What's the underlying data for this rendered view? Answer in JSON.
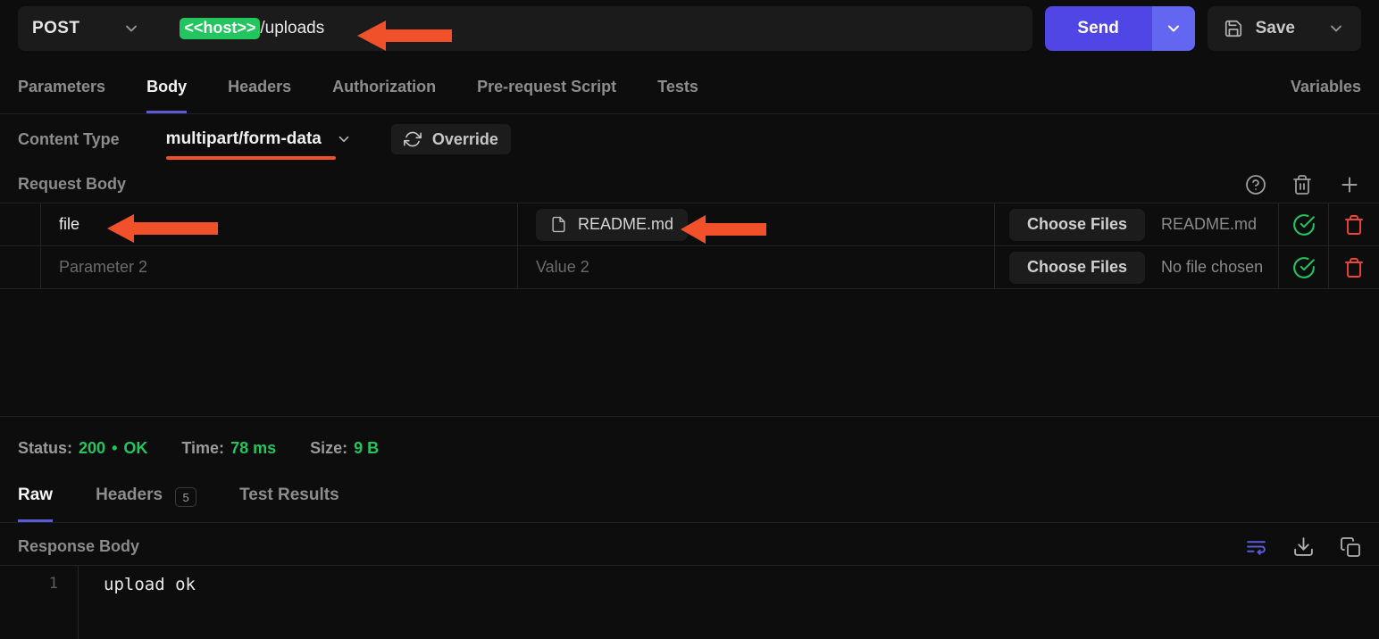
{
  "request_bar": {
    "method": "POST",
    "url_variable": "<<host>>",
    "url_path": "/uploads",
    "send_label": "Send",
    "save_label": "Save",
    "accent_color": "#4f46e5",
    "variable_chip_color": "#22c55e"
  },
  "request_tabs": {
    "items": [
      {
        "label": "Parameters",
        "active": false
      },
      {
        "label": "Body",
        "active": true
      },
      {
        "label": "Headers",
        "active": false
      },
      {
        "label": "Authorization",
        "active": false
      },
      {
        "label": "Pre-request Script",
        "active": false
      },
      {
        "label": "Tests",
        "active": false
      }
    ],
    "right_item": "Variables"
  },
  "content_type": {
    "label": "Content Type",
    "value": "multipart/form-data",
    "override_label": "Override",
    "underline_color": "#f0502a"
  },
  "request_body": {
    "title": "Request Body",
    "icons": [
      "help-circle-icon",
      "trash-icon",
      "plus-icon"
    ],
    "rows": [
      {
        "key": "file",
        "key_is_placeholder": false,
        "value": "README.md",
        "value_is_placeholder": false,
        "value_is_file_chip": true,
        "choose_files_label": "Choose Files",
        "file_status": "README.md",
        "file_status_muted": false
      },
      {
        "key": "Parameter 2",
        "key_is_placeholder": true,
        "value": "Value 2",
        "value_is_placeholder": true,
        "value_is_file_chip": false,
        "choose_files_label": "Choose Files",
        "file_status": "No file chosen",
        "file_status_muted": true
      }
    ]
  },
  "status": {
    "status_label": "Status:",
    "status_value": "200",
    "status_sep": "•",
    "status_text": "OK",
    "time_label": "Time:",
    "time_value": "78 ms",
    "size_label": "Size:",
    "size_value": "9 B",
    "success_color": "#22c55e"
  },
  "response_tabs": {
    "items": [
      {
        "label": "Raw",
        "active": true,
        "badge": ""
      },
      {
        "label": "Headers",
        "active": false,
        "badge": "5"
      },
      {
        "label": "Test Results",
        "active": false,
        "badge": ""
      }
    ]
  },
  "response_body": {
    "title": "Response Body",
    "icons": [
      "word-wrap-icon",
      "download-icon",
      "copy-icon"
    ],
    "line_number": "1",
    "content": "upload ok"
  },
  "annotations": {
    "arrow_color": "#f0502a",
    "arrows": [
      {
        "name": "arrow-to-url",
        "target": "url-field"
      },
      {
        "name": "arrow-to-param-key",
        "target": "param-key-file"
      },
      {
        "name": "arrow-to-file-chip",
        "target": "file-chip-readme"
      }
    ]
  }
}
